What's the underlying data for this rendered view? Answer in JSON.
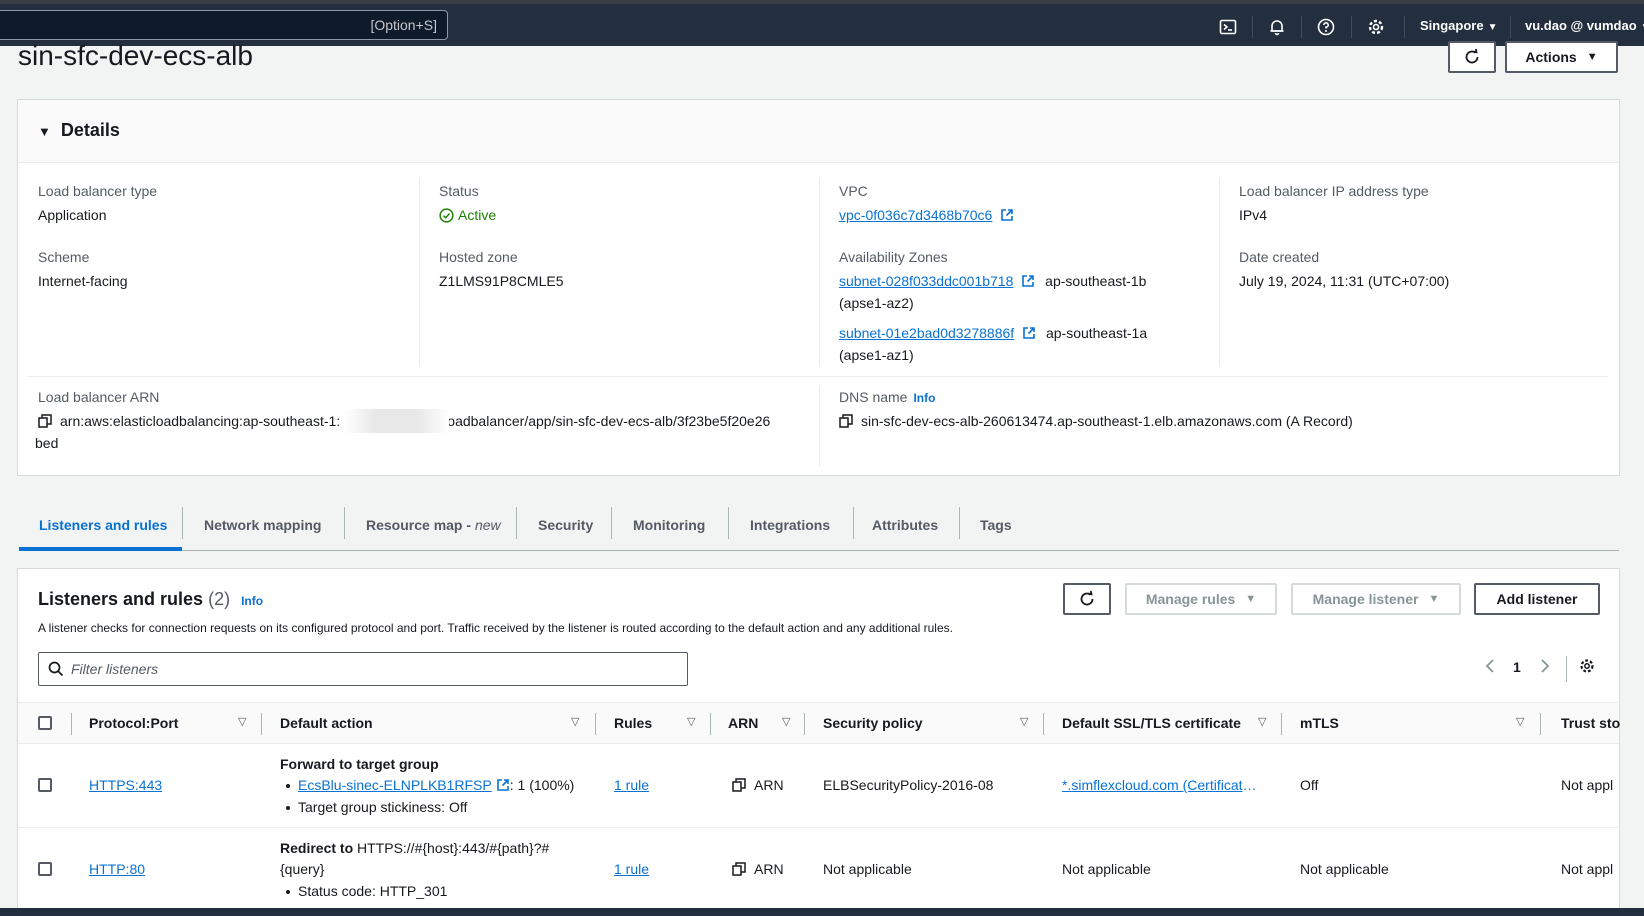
{
  "topnav": {
    "search_hint": "[Option+S]",
    "region": "Singapore",
    "account": "vu.dao @ vumdao",
    "icons": [
      "cloudshell-icon",
      "bell-icon",
      "help-icon",
      "gear-icon"
    ]
  },
  "header": {
    "title": "sin-sfc-dev-ecs-alb",
    "actions_label": "Actions"
  },
  "details": {
    "title": "Details",
    "lb_type_label": "Load balancer type",
    "lb_type": "Application",
    "scheme_label": "Scheme",
    "scheme": "Internet-facing",
    "status_label": "Status",
    "status": "Active",
    "hosted_zone_label": "Hosted zone",
    "hosted_zone": "Z1LMS91P8CMLE5",
    "vpc_label": "VPC",
    "vpc": "vpc-0f036c7d3468b70c6",
    "az_label": "Availability Zones",
    "az": [
      {
        "subnet": "subnet-028f033ddc001b718",
        "zone": "ap-southeast-1b",
        "zone_id": "(apse1-az2)"
      },
      {
        "subnet": "subnet-01e2bad0d3278886f",
        "zone": "ap-southeast-1a",
        "zone_id": "(apse1-az1)"
      }
    ],
    "ip_type_label": "Load balancer IP address type",
    "ip_type": "IPv4",
    "date_label": "Date created",
    "date": "July 19, 2024, 11:31 (UTC+07:00)",
    "arn_label": "Load balancer ARN",
    "arn_part1": "arn:aws:elasticloadbalancing:ap-southeast-1:",
    "arn_part2": "loadbalancer/app/sin-sfc-dev-ecs-alb/3f23be5f20e26",
    "arn_part3": "bed",
    "dns_label": "DNS name",
    "dns_info": "Info",
    "dns": "sin-sfc-dev-ecs-alb-260613474.ap-southeast-1.elb.amazonaws.com (A Record)"
  },
  "tabs": [
    {
      "label": "Listeners and rules",
      "suffix": ""
    },
    {
      "label": "Network mapping",
      "suffix": ""
    },
    {
      "label": "Resource map - ",
      "suffix": "new"
    },
    {
      "label": "Security",
      "suffix": ""
    },
    {
      "label": "Monitoring",
      "suffix": ""
    },
    {
      "label": "Integrations",
      "suffix": ""
    },
    {
      "label": "Attributes",
      "suffix": ""
    },
    {
      "label": "Tags",
      "suffix": ""
    }
  ],
  "listeners": {
    "title": "Listeners and rules",
    "count": "(2)",
    "info": "Info",
    "description": "A listener checks for connection requests on its configured protocol and port. Traffic received by the listener is routed according to the default action and any additional rules.",
    "manage_rules_label": "Manage rules",
    "manage_listener_label": "Manage listener",
    "add_listener_label": "Add listener",
    "filter_placeholder": "Filter listeners",
    "page": "1",
    "columns": [
      "Protocol:Port",
      "Default action",
      "Rules",
      "ARN",
      "Security policy",
      "Default SSL/TLS certificate",
      "mTLS",
      "Trust sto"
    ],
    "rows": [
      {
        "protocol": "HTTPS:443",
        "action_title": "Forward to target group",
        "action_tg": "EcsBlu-sinec-ELNPLKB1RFSP",
        "action_weight": ": 1 (100%)",
        "action_line2": "Target group stickiness: Off",
        "rules": "1 rule",
        "arn": "ARN",
        "policy": "ELBSecurityPolicy-2016-08",
        "cert": "*.simflexcloud.com (Certificate ID)",
        "mtls": "Off",
        "trust": "Not appl"
      },
      {
        "protocol": "HTTP:80",
        "action_title": "Redirect to",
        "action_target": "HTTPS://#{host}:443/#{path}?#",
        "action_target2": "{query}",
        "action_line2": "Status code: HTTP_301",
        "rules": "1 rule",
        "arn": "ARN",
        "policy": "Not applicable",
        "cert": "Not applicable",
        "mtls": "Not applicable",
        "trust": "Not appl"
      }
    ]
  }
}
